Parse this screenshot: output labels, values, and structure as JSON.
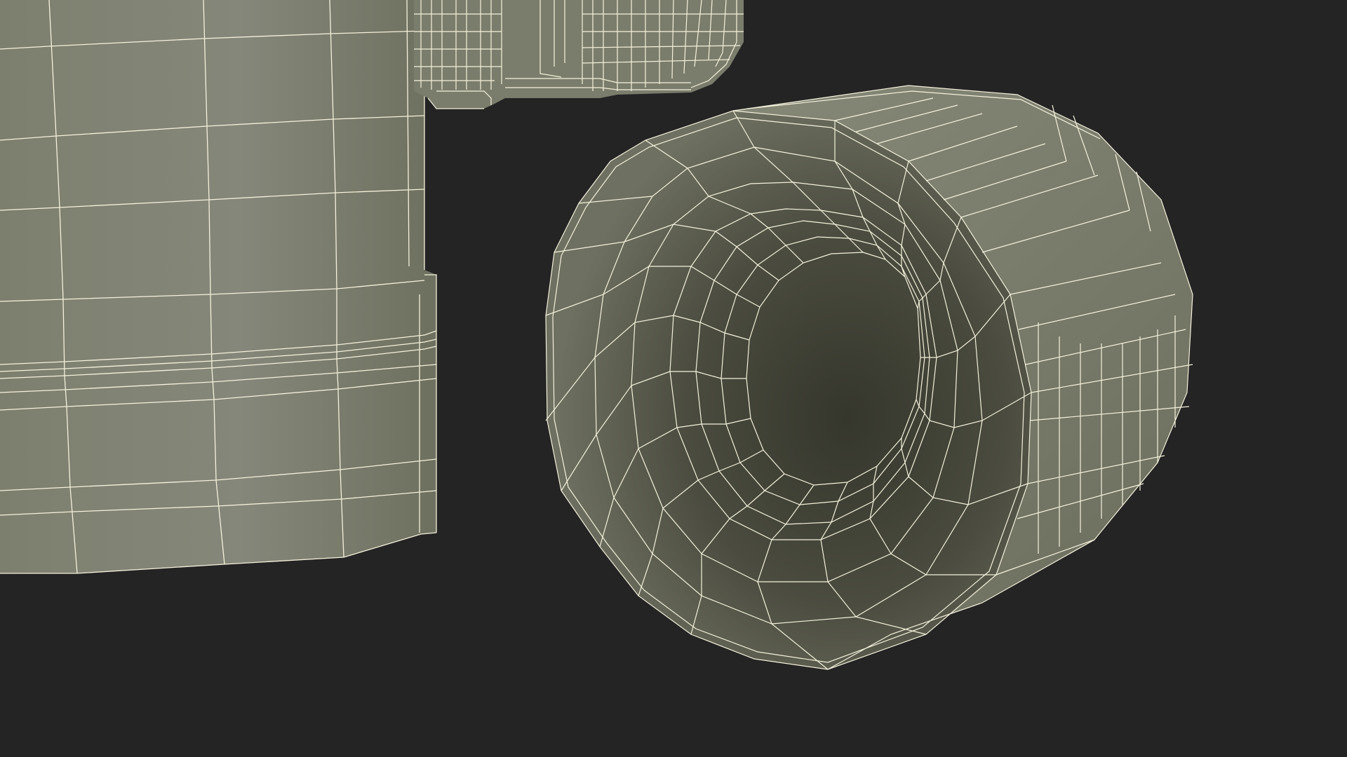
{
  "scene": {
    "background_color": "#242424",
    "mesh_fill_color": "#7d7f6e",
    "mesh_fill_dark": "#5c5e4e",
    "mesh_interior_color": "#4a4b3e",
    "mesh_interior_deep": "#35362c",
    "wireframe_color": "#f4f2dc",
    "objects": [
      {
        "name": "container-body",
        "style": "wireframe-over-shaded"
      },
      {
        "name": "container-lid-hinge",
        "style": "wireframe-over-shaded"
      },
      {
        "name": "cylindrical-cap",
        "style": "wireframe-over-shaded"
      }
    ]
  }
}
